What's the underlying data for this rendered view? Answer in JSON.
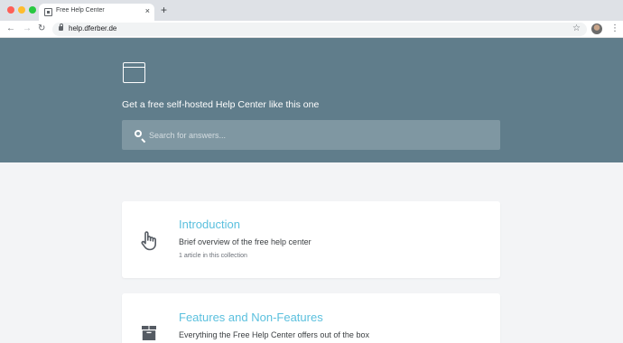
{
  "browser": {
    "tab_title": "Free Help Center",
    "tab_close": "×",
    "new_tab": "+",
    "url": "help.dferber.de",
    "back": "←",
    "forward": "→",
    "reload": "↻",
    "star": "☆",
    "menu": "⋮"
  },
  "hero": {
    "logo_icon": "browser-window-icon",
    "tagline": "Get a free self-hosted Help Center like this one",
    "search_placeholder": "Search for answers..."
  },
  "collections": [
    {
      "icon": "hand-pointer-icon",
      "title": "Introduction",
      "description": "Brief overview of the free help center",
      "count": "1 article in this collection"
    },
    {
      "icon": "box-icon",
      "title": "Features and Non-Features",
      "description": "Everything the Free Help Center offers out of the box"
    }
  ],
  "colors": {
    "hero_background": "#607d8b",
    "search_background": "#7f97a2",
    "title_accent": "#5bc0de",
    "page_background": "#f3f4f6"
  }
}
